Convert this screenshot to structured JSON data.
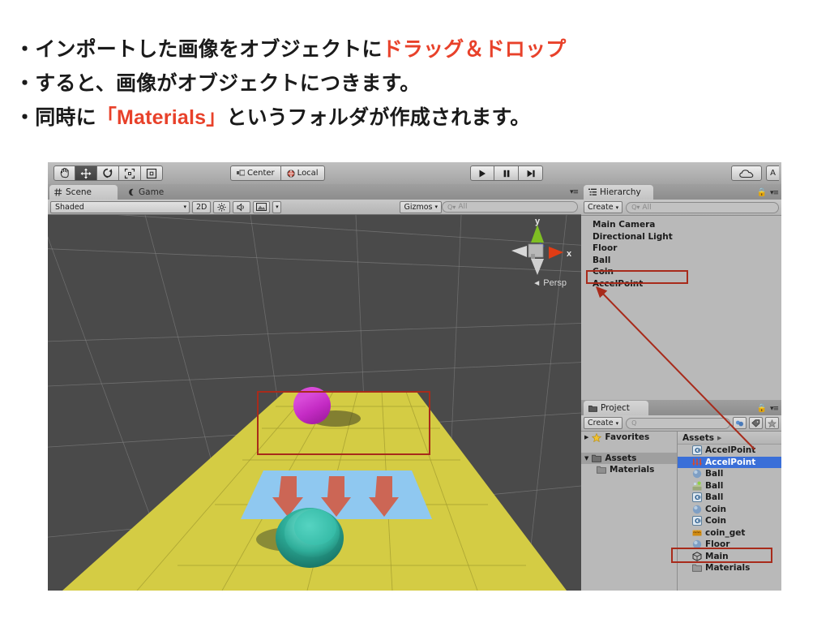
{
  "slide": {
    "lines": [
      {
        "prefix": "・インポートした画像をオブジェクトに",
        "highlight": "ドラッグ＆ドロップ",
        "suffix": ""
      },
      {
        "prefix": "・すると、画像がオブジェクトにつきます。",
        "highlight": "",
        "suffix": ""
      },
      {
        "prefix": "・同時に",
        "highlight": "「Materials」",
        "suffix": "というフォルダが作成されます。"
      }
    ],
    "highlight_color": "#e8412a",
    "text_color": "#1a1a1a"
  },
  "editor": {
    "toolbar": {
      "transform_tools": [
        {
          "name": "hand-tool",
          "icon": "hand-icon",
          "active": false
        },
        {
          "name": "move-tool",
          "icon": "move-icon",
          "active": true
        },
        {
          "name": "rotate-tool",
          "icon": "rotate-icon",
          "active": false
        },
        {
          "name": "scale-tool",
          "icon": "scale-icon",
          "active": false
        },
        {
          "name": "rect-tool",
          "icon": "rect-icon",
          "active": false
        }
      ],
      "pivot_buttons": [
        {
          "label": "Center",
          "icon": "pivot-icon"
        },
        {
          "label": "Local",
          "icon": "globe-icon"
        }
      ],
      "play_buttons": [
        {
          "name": "play-button",
          "icon": "play-icon"
        },
        {
          "name": "pause-button",
          "icon": "pause-icon"
        },
        {
          "name": "step-button",
          "icon": "step-icon"
        }
      ],
      "cloud_label": "cloud-icon",
      "account_label": "A"
    },
    "scene_panel": {
      "tabs": [
        {
          "label": "Scene",
          "icon": "scene-grid-icon",
          "active": true
        },
        {
          "label": "Game",
          "icon": "game-icon",
          "active": false
        }
      ],
      "toolbar": {
        "shading_mode": "Shaded",
        "mode_2d": "2D",
        "lighting_icon": "sun-icon",
        "audio_icon": "speaker-icon",
        "effects_icon": "image-icon",
        "gizmos_label": "Gizmos",
        "search_placeholder": "All"
      },
      "gizmo": {
        "axis_x_label": "x",
        "axis_y_label": "y",
        "projection_label": "Persp",
        "axis_x_color": "#e03c14",
        "axis_y_color": "#7fbf23",
        "axis_z_color": "#2a46c8"
      },
      "scene_objects": {
        "floor_color": "#d4cc44",
        "ball_color": "#c72bc7",
        "coin_color": "#1f8f80",
        "accel_plane_color": "#8fc8f0",
        "accel_arrow_color": "#cc6655",
        "background_color": "#4a4a4a",
        "arrow_count": 3
      }
    },
    "hierarchy_panel": {
      "tab_label": "Hierarchy",
      "tab_icon": "hierarchy-icon",
      "create_label": "Create",
      "search_placeholder": "All",
      "lock_icon": "lock-icon",
      "menu_icon": "panel-menu-icon",
      "items": [
        {
          "label": "Main Camera",
          "highlighted": false
        },
        {
          "label": "Directional Light",
          "highlighted": false
        },
        {
          "label": "Floor",
          "highlighted": false
        },
        {
          "label": "Ball",
          "highlighted": false
        },
        {
          "label": "Coin",
          "highlighted": false
        },
        {
          "label": "AccelPoint",
          "highlighted": true
        }
      ]
    },
    "project_panel": {
      "tab_label": "Project",
      "tab_icon": "folder-icon",
      "create_label": "Create",
      "search_placeholder": "",
      "lock_icon": "lock-icon",
      "menu_icon": "panel-menu-icon",
      "toolbar_icons": [
        "filter-icon",
        "label-icon",
        "star-icon"
      ],
      "tree": [
        {
          "label": "Favorites",
          "icon": "star-icon",
          "expanded": false,
          "indent": 0,
          "selected": false
        },
        {
          "label": "Assets",
          "icon": "folder-icon",
          "expanded": true,
          "indent": 0,
          "selected": true
        },
        {
          "label": "Materials",
          "icon": "folder-icon",
          "expanded": false,
          "indent": 1,
          "selected": false
        }
      ],
      "breadcrumb": "Assets",
      "assets": [
        {
          "label": "AccelPoint",
          "icon": "csharp-icon",
          "selected": false,
          "boxed": false
        },
        {
          "label": "AccelPoint",
          "icon": "texture-arrows-icon",
          "selected": true,
          "boxed": false
        },
        {
          "label": "Ball",
          "icon": "material-icon",
          "selected": false,
          "boxed": false
        },
        {
          "label": "Ball",
          "icon": "prefab-icon",
          "selected": false,
          "boxed": false
        },
        {
          "label": "Ball",
          "icon": "csharp-icon",
          "selected": false,
          "boxed": false
        },
        {
          "label": "Coin",
          "icon": "material-icon",
          "selected": false,
          "boxed": false
        },
        {
          "label": "Coin",
          "icon": "csharp-icon",
          "selected": false,
          "boxed": false
        },
        {
          "label": "coin_get",
          "icon": "audio-icon",
          "selected": false,
          "boxed": false
        },
        {
          "label": "Floor",
          "icon": "material-icon",
          "selected": false,
          "boxed": false
        },
        {
          "label": "Main",
          "icon": "scene-icon",
          "selected": false,
          "boxed": false
        },
        {
          "label": "Materials",
          "icon": "folder-icon",
          "selected": false,
          "boxed": true
        }
      ]
    },
    "annotations": {
      "box_color": "#a82b1b",
      "arrow_description": "arrow from selected AccelPoint asset to AccelPoint in Hierarchy"
    }
  }
}
